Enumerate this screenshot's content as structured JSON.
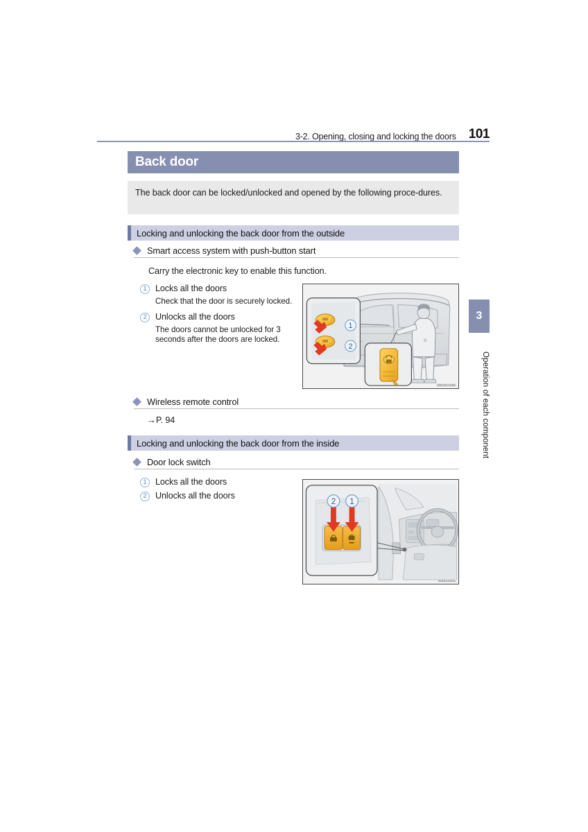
{
  "header": {
    "chapter_title": "3-2. Opening, closing and locking the doors",
    "page_number": "101"
  },
  "title_banner": {
    "text": "Back door"
  },
  "intro": {
    "text": "The back door can be locked/unlocked and opened by the following proce-dures."
  },
  "sections": [
    {
      "id": "outside",
      "bar_label": "Locking and unlocking the back door from the outside",
      "subheads": [
        {
          "label": "Smart access system with push-button start"
        },
        {
          "label": "Wireless remote control"
        }
      ],
      "carry_line": "Carry the electronic key to enable this function.",
      "page_ref": "P. 94",
      "page_ref_arrow": "→",
      "items": [
        {
          "number": "1",
          "label": "Locks all the doors",
          "note": "Check that the door is securely locked."
        },
        {
          "number": "2",
          "label": "Unlocks all the doors",
          "note": "The doors cannot be unlocked for 3 seconds after the doors are locked."
        }
      ],
      "figure": {
        "name": "back-door-exterior-illustration",
        "code": "IND3GA096",
        "callout_numbers": [
          "1",
          "2"
        ]
      }
    },
    {
      "id": "inside",
      "bar_label": "Locking and unlocking the back door from the inside",
      "subheads": [
        {
          "label": "Door lock switch"
        }
      ],
      "items": [
        {
          "number": "1",
          "label": "Locks all the doors"
        },
        {
          "number": "2",
          "label": "Unlocks all the doors"
        }
      ],
      "figure": {
        "name": "door-lock-switch-illustration",
        "code": "IN83G4001",
        "callout_numbers": [
          "2",
          "1"
        ]
      }
    }
  ],
  "side_tab": {
    "chapter_number": "3",
    "chapter_name": "Operation of each component"
  },
  "colors": {
    "banner": "#868fb0",
    "section_bar": "#ccd0e2",
    "section_accent": "#6e7aa3",
    "intro_bg": "#e9e9e9",
    "diamond": "#8b93bb",
    "circle_number": "#5b87ae",
    "rule": "#8b93b3",
    "arrow_red": "#e03a23",
    "button_yellow": "#f4b73f"
  }
}
